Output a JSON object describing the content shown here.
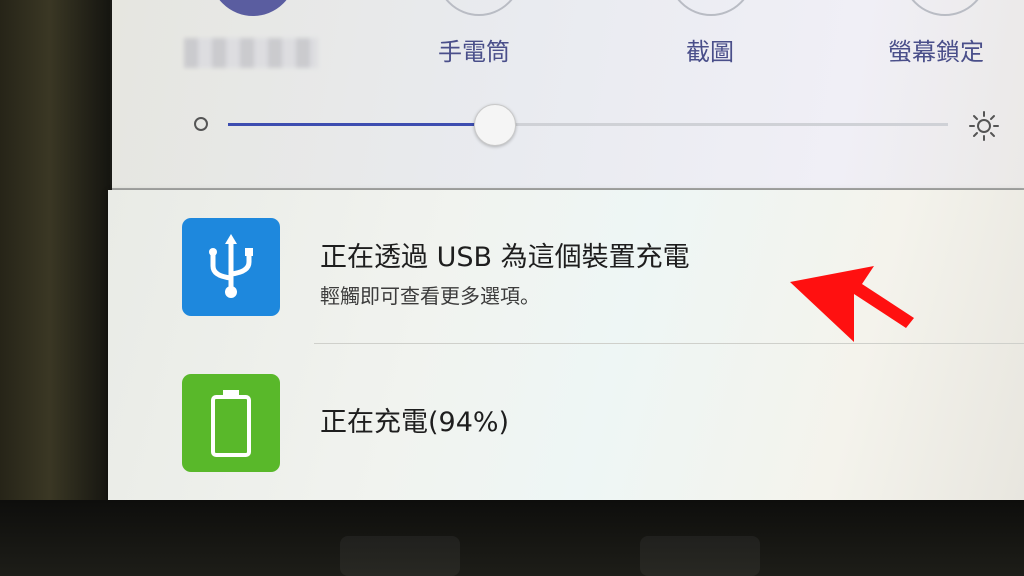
{
  "quick_settings": {
    "tiles": [
      {
        "label": ""
      },
      {
        "label": "手電筒"
      },
      {
        "label": "截圖"
      },
      {
        "label": "螢幕鎖定"
      }
    ],
    "brightness": {
      "level": 0.37
    }
  },
  "notifications": [
    {
      "icon": "usb-icon",
      "icon_bg": "#1e88dd",
      "title": "正在透過 USB 為這個裝置充電",
      "subtitle": "輕觸即可查看更多選項。"
    },
    {
      "icon": "battery-icon",
      "icon_bg": "#59b82a",
      "title": "正在充電(94%)"
    }
  ],
  "annotation": {
    "color": "#ff1010"
  }
}
